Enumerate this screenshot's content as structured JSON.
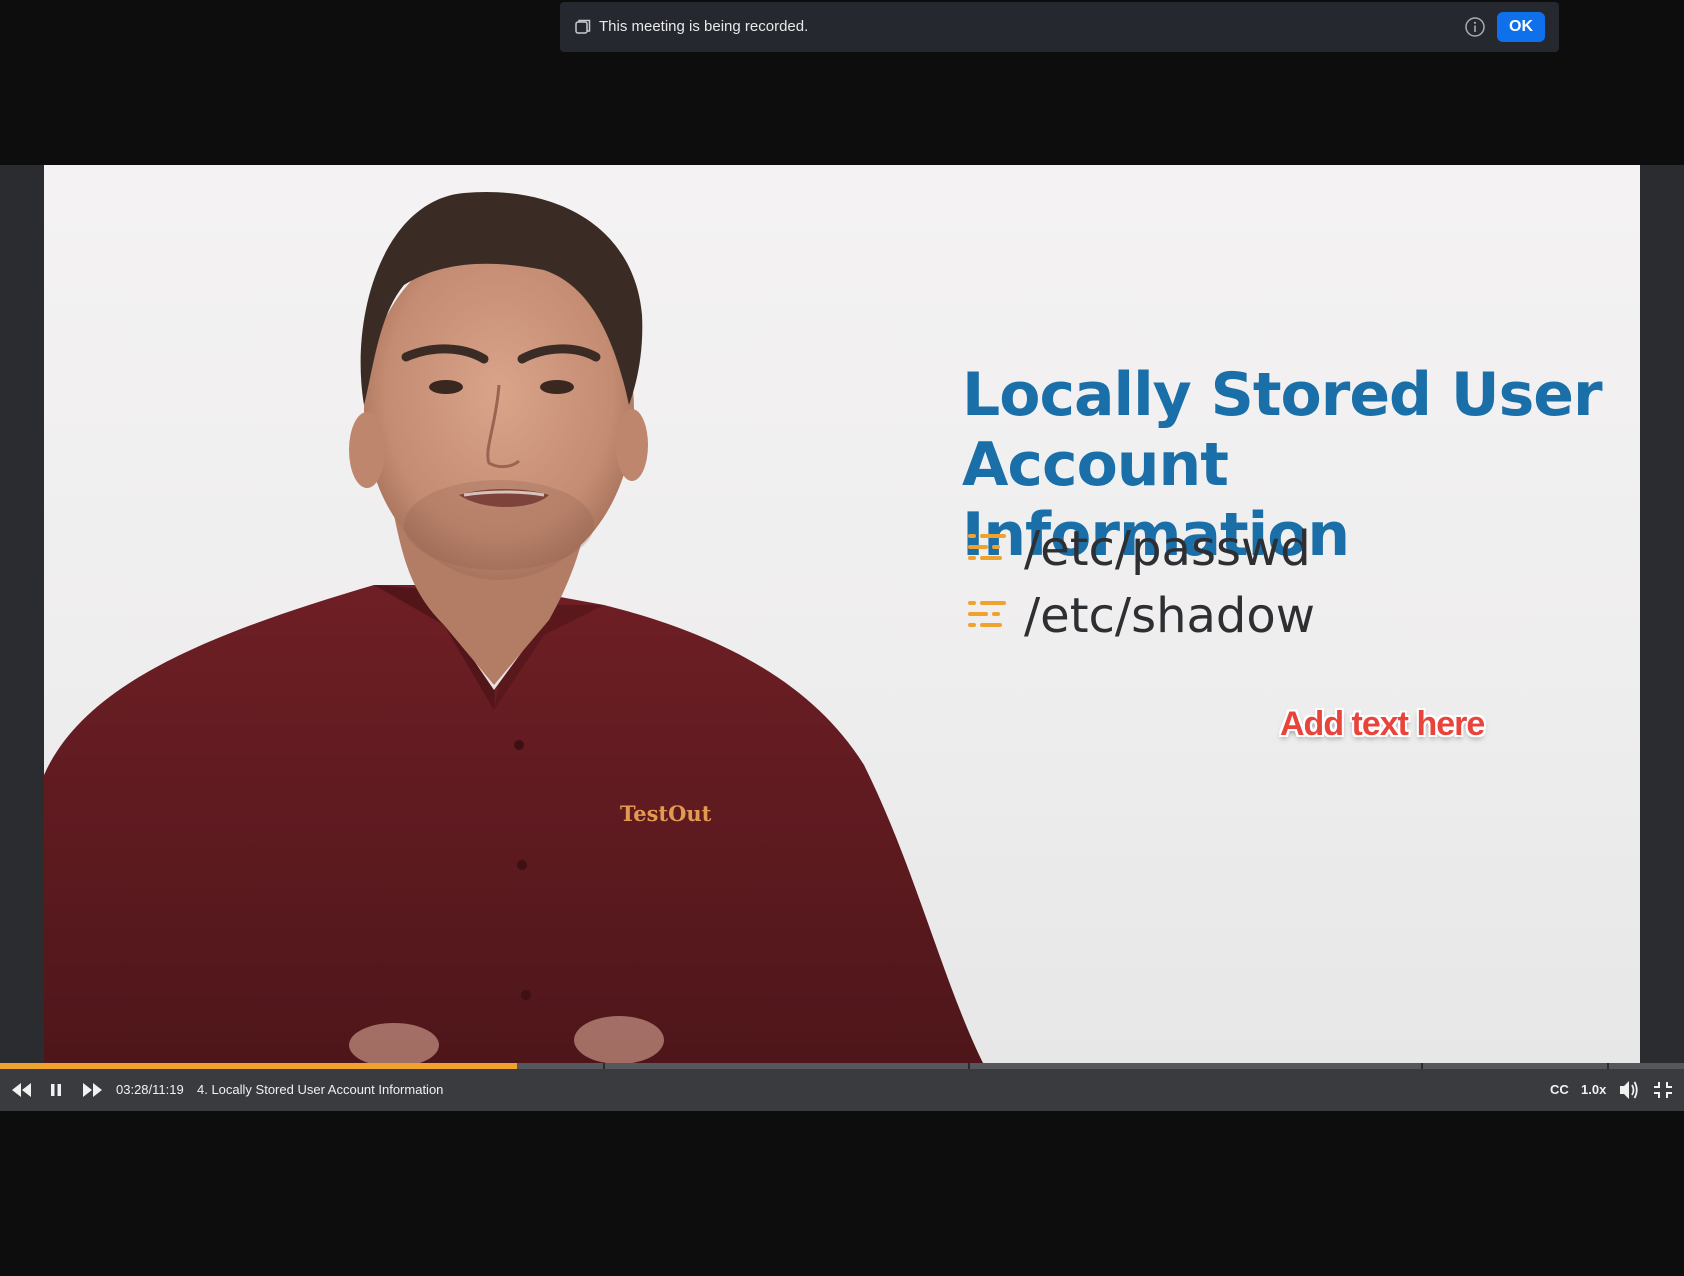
{
  "banner": {
    "message": "This meeting is being recorded.",
    "ok_label": "OK"
  },
  "slide": {
    "title_line1": "Locally Stored User",
    "title_line2": "Account Information",
    "bullets": [
      "/etc/passwd",
      "/etc/shadow"
    ],
    "overlay_text": "Add text here",
    "shirt_logo": "TestOut"
  },
  "player": {
    "elapsed": "03:28",
    "duration": "11:19",
    "time_display": "03:28/11:19",
    "chapter_title": "4. Locally Stored User Account Information",
    "progress_fraction": 0.307,
    "chapter_marks": [
      0.358,
      0.575,
      0.844,
      0.954
    ],
    "cc_label": "CC",
    "speed_label": "1.0x"
  },
  "colors": {
    "accent_blue": "#0e71eb",
    "progress_orange": "#f0a22e",
    "title_blue": "#1a6fa8",
    "overlay_red": "#e8443b"
  },
  "icons": {
    "banner_left": "recording-icon",
    "banner_info": "info-icon",
    "rewind": "rewind-icon",
    "pause": "pause-icon",
    "forward": "fast-forward-icon",
    "volume": "volume-icon",
    "exit_fullscreen": "exit-fullscreen-icon",
    "bullet": "list-bullet-icon"
  }
}
